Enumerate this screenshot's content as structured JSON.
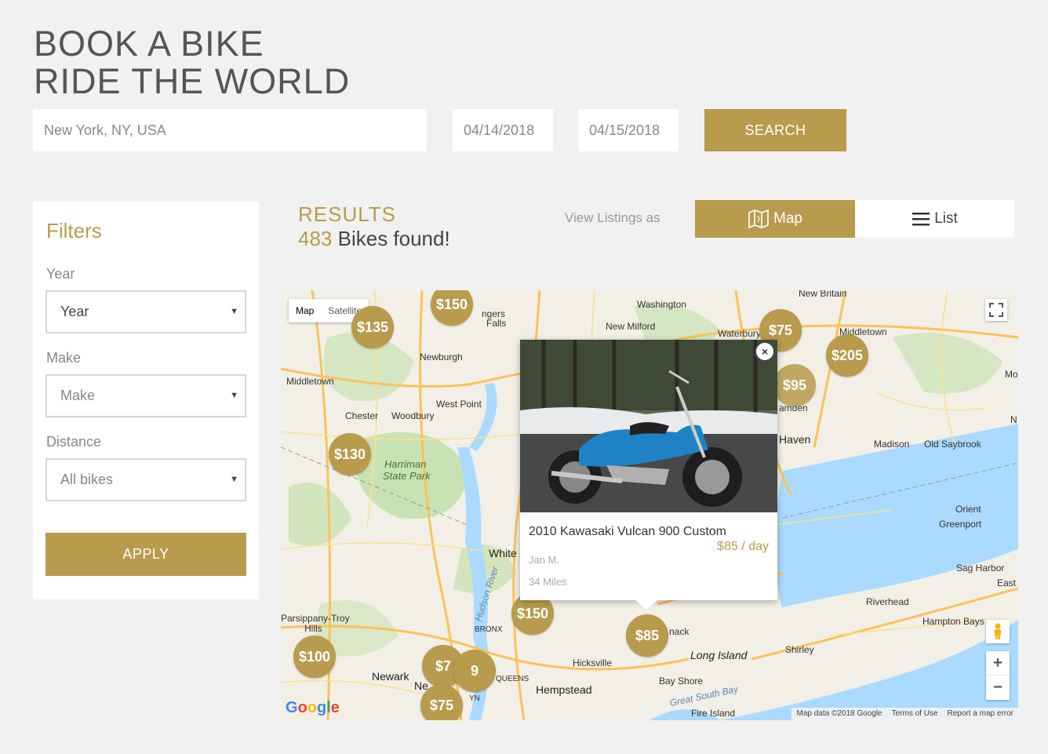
{
  "hero": {
    "line1": "BOOK A BIKE",
    "line2": "RIDE THE WORLD"
  },
  "search": {
    "location_value": "New York, NY, USA",
    "start_date": "04/14/2018",
    "end_date": "04/15/2018",
    "button_label": "SEARCH"
  },
  "filters": {
    "title": "Filters",
    "year_label": "Year",
    "year_value": "Year",
    "make_label": "Make",
    "make_value": "Make",
    "distance_label": "Distance",
    "distance_value": "All bikes",
    "apply_label": "APPLY"
  },
  "results": {
    "label": "RESULTS",
    "count": "483",
    "count_suffix": " Bikes found!",
    "view_as": "View Listings as",
    "map_label": "Map",
    "list_label": "List"
  },
  "map": {
    "type_map": "Map",
    "type_satellite": "Satellite",
    "attribution": [
      "Map data ©2018 Google",
      "Terms of Use",
      "Report a map error"
    ],
    "google": "Google",
    "zoom_in": "+",
    "zoom_out": "−",
    "labels": [
      "Newburgh",
      "Middletown",
      "Chester",
      "Woodbury",
      "West Point",
      "Harriman",
      "State Park",
      "Washington",
      "New Milford",
      "Waterbury",
      "New Britain",
      "Middletown",
      "Haven",
      "Madison",
      "Old Saybrook",
      "Orient",
      "Greenport",
      "Sag Harbor",
      "East Ha",
      "Riverhead",
      "Hampton Bays",
      "Shirley",
      "Long Island",
      "Bay Shore",
      "Great South Bay",
      "Fire Island",
      "Hicksville",
      "Hempstead",
      "QUEENS",
      "BRONX",
      "White",
      "Hudson River",
      "Newark",
      "Parsippany-Troy",
      "Hills",
      "Mo",
      "amden",
      "ngers",
      "Falls",
      "nack",
      "Ne",
      "YN",
      "N"
    ],
    "pins": [
      "$150",
      "$135",
      "$75",
      "$205",
      "$95",
      "$130",
      "$150",
      "$85",
      "$100",
      "$7",
      "9",
      "$75"
    ]
  },
  "listing": {
    "title": "2010 Kawasaki Vulcan 900 Custom",
    "price": "$85 / day",
    "owner": "Jan M.",
    "distance": "34 Miles",
    "close": "×"
  },
  "colors": {
    "accent": "#b89b4c",
    "background": "#f1f1f1"
  }
}
